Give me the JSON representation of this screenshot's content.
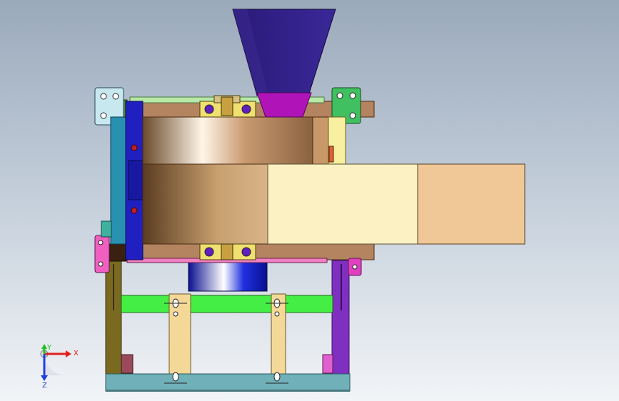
{
  "triad": {
    "x_label": "X",
    "y_label": "Y",
    "z_label": "Z",
    "x_color": "#e02020",
    "y_color": "#20c020",
    "z_color": "#2040e0"
  },
  "colors": {
    "background_top": "#9aa9bb",
    "background_bottom": "#f2f4f7",
    "hopper": "#2a1870",
    "hopper_outlet": "#b014b8",
    "drum": "#b8926a",
    "belt_light": "#fbf1c2",
    "belt_tan": "#f0c898",
    "frame_green": "#44ee44",
    "frame_purple": "#8030c0",
    "frame_olive": "#7a6a20",
    "base_teal": "#70b0b8",
    "magenta": "#e020a0",
    "side_panel_blue": "#2020c0",
    "motor_blue": "#1c2ad0"
  }
}
